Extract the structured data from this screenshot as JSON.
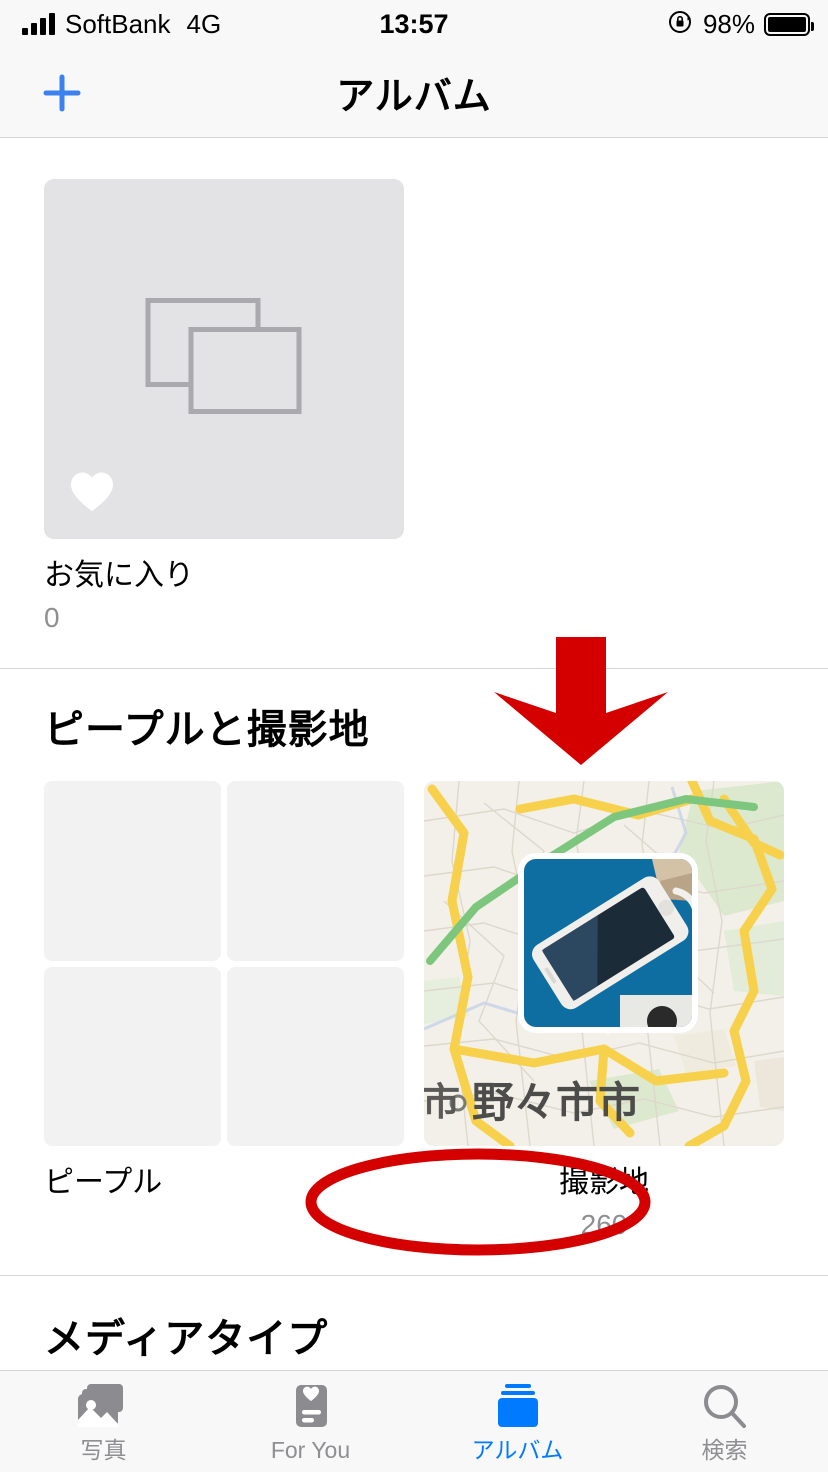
{
  "status_bar": {
    "carrier": "SoftBank",
    "network": "4G",
    "time": "13:57",
    "battery_percent": "98%",
    "icons": {
      "signal": "signal-bars-icon",
      "orientation_lock": "rotation-lock-icon",
      "battery": "battery-full-icon"
    }
  },
  "nav_bar": {
    "title": "アルバム",
    "add_icon": "plus-icon"
  },
  "albums_section": {
    "items": [
      {
        "title": "お気に入り",
        "count": "0",
        "placeholder_icon": "stacked-photos-icon",
        "badge_icon": "heart-icon"
      }
    ]
  },
  "people_places_section": {
    "header": "ピープルと撮影地",
    "items": [
      {
        "label": "ピープル",
        "count": "",
        "thumb_type": "people-grid"
      },
      {
        "label": "撮影地",
        "count": "260",
        "thumb_type": "map",
        "map_label": "野々市市",
        "map_label_partial": "市",
        "pin_photo_description": "white-iphone-on-blue-surface"
      }
    ]
  },
  "media_types_section": {
    "header": "メディアタイプ"
  },
  "annotations": [
    {
      "name": "red-down-arrow",
      "type": "arrow",
      "color": "#d40000",
      "target": "撮影地"
    },
    {
      "name": "red-ellipse",
      "type": "ellipse",
      "color": "#d40000",
      "target": "撮影地 260"
    }
  ],
  "tab_bar": {
    "active": "アルバム",
    "tabs": [
      {
        "label": "写真",
        "icon": "photos-icon",
        "active": false
      },
      {
        "label": "For You",
        "icon": "foryou-icon",
        "active": false
      },
      {
        "label": "アルバム",
        "icon": "albums-icon",
        "active": true
      },
      {
        "label": "検索",
        "icon": "search-icon",
        "active": false
      }
    ]
  },
  "colors": {
    "accent": "#007aff",
    "annotation": "#d40000",
    "inactive": "#8e8e93",
    "chrome": "#f8f8f8",
    "placeholder": "#e3e3e5"
  }
}
